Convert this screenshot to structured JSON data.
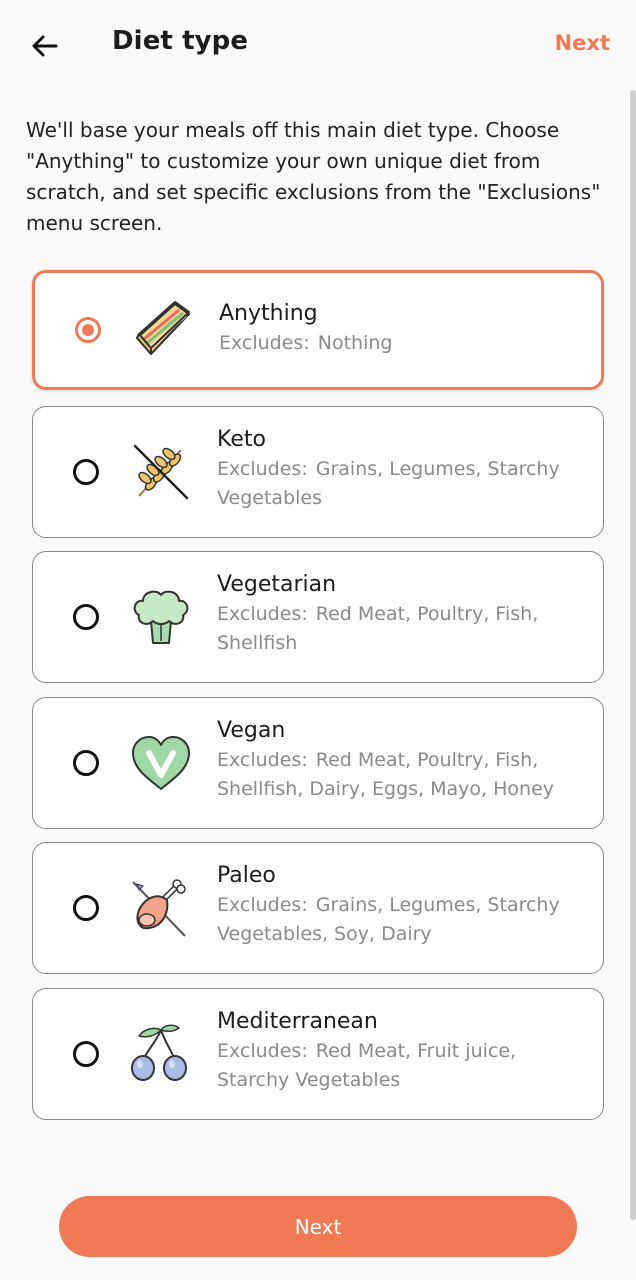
{
  "header": {
    "title": "Diet type",
    "next_label": "Next"
  },
  "description": "We'll base your meals off this main diet type. Choose \"Anything\" to customize your own unique diet from scratch, and set specific exclusions from the \"Exclusions\" menu screen.",
  "excludes_label": "Excludes:",
  "options": [
    {
      "name": "Anything",
      "excludes": "Nothing",
      "icon": "sandwich-icon",
      "selected": true
    },
    {
      "name": "Keto",
      "excludes": "Grains, Legumes, Starchy Vegetables",
      "icon": "crossed-grain-icon",
      "selected": false
    },
    {
      "name": "Vegetarian",
      "excludes": "Red Meat, Poultry, Fish, Shellfish",
      "icon": "broccoli-icon",
      "selected": false
    },
    {
      "name": "Vegan",
      "excludes": "Red Meat, Poultry, Fish, Shellfish, Dairy, Eggs, Mayo, Honey",
      "icon": "vegan-heart-icon",
      "selected": false
    },
    {
      "name": "Paleo",
      "excludes": "Grains, Legumes, Starchy Vegetables, Soy, Dairy",
      "icon": "meat-leg-icon",
      "selected": false
    },
    {
      "name": "Mediterranean",
      "excludes": "Red Meat, Fruit juice, Starchy Vegetables",
      "icon": "olives-icon",
      "selected": false
    }
  ],
  "footer": {
    "next_label": "Next"
  },
  "colors": {
    "accent": "#ef7a55",
    "border": "#8a8a8a",
    "muted_text": "#8a8a8a"
  }
}
